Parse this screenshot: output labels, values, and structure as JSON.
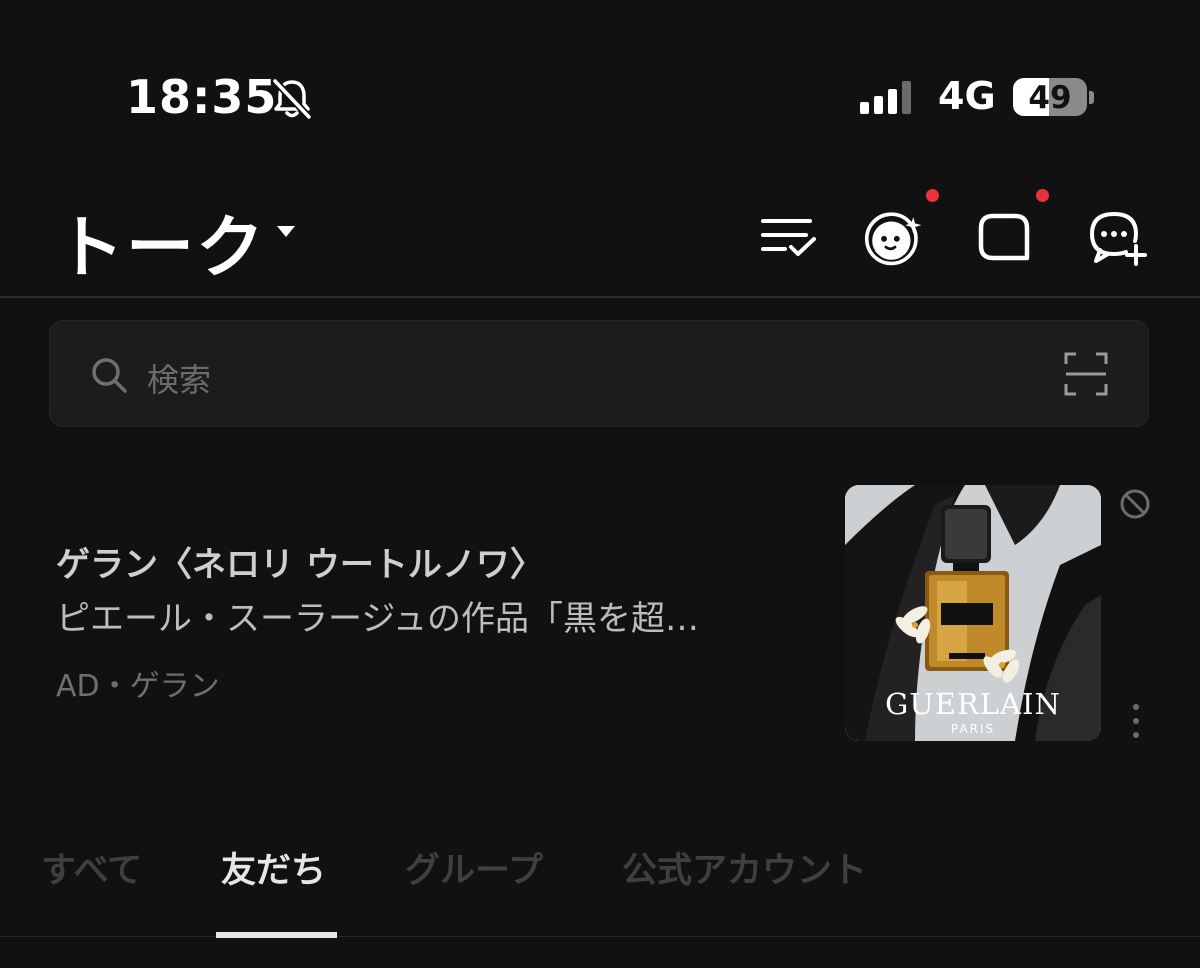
{
  "status_bar": {
    "time": "18:35",
    "network": "4G",
    "battery": "49",
    "battery_level": 0.49,
    "signal_bars_active": 3,
    "signal_bars_total": 4
  },
  "header": {
    "title": "トーク",
    "icons": [
      "edit-list-icon",
      "mascot-face-icon",
      "voom-icon",
      "new-chat-icon"
    ]
  },
  "search": {
    "placeholder": "検索"
  },
  "ad": {
    "title": "ゲラン〈ネロリ ウートルノワ〉",
    "body": "ピエール・スーラージュの作品「黒を超…",
    "meta": "AD・ゲラン",
    "image_brand": "GUERLAIN",
    "image_sub": "PARIS"
  },
  "tabs": [
    {
      "label": "すべて",
      "active": false
    },
    {
      "label": "友だち",
      "active": true
    },
    {
      "label": "グループ",
      "active": false
    },
    {
      "label": "公式アカウント",
      "active": false
    }
  ],
  "colors": {
    "background": "#111111",
    "notification_dot": "#e8323c"
  }
}
